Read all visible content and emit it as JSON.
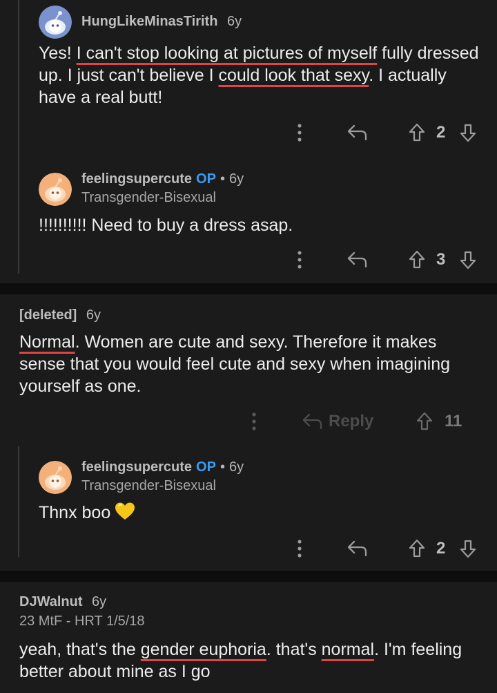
{
  "thread1": {
    "comment1": {
      "username": "HungLikeMinasTirith",
      "age": "6y",
      "body_parts": [
        "Yes! ",
        "I can't stop looking at pictures of myself",
        " fully dressed up. I just can't believe I ",
        "could look that sexy",
        ". I actually have a real butt!"
      ],
      "votes": "2"
    },
    "reply1": {
      "username": "feelingsupercute",
      "op_label": "OP",
      "age": "6y",
      "flair": "Transgender-Bisexual",
      "body": "!!!!!!!!!! Need to buy a dress asap.",
      "votes": "3"
    }
  },
  "thread2": {
    "comment1": {
      "username": "[deleted]",
      "age": "6y",
      "body_parts": [
        "Normal",
        ". Women are cute and sexy. Therefore it makes sense that you would feel cute and sexy when imagining yourself as one."
      ],
      "reply_label": "Reply",
      "votes": "11"
    },
    "reply1": {
      "username": "feelingsupercute",
      "op_label": "OP",
      "age": "6y",
      "flair": "Transgender-Bisexual",
      "body": "Thnx boo",
      "votes": "2"
    }
  },
  "thread3": {
    "comment1": {
      "username": "DJWalnut",
      "age": "6y",
      "flair": "23 MtF - HRT 1/5/18",
      "body_parts": [
        "yeah, that's the ",
        "gender euphoria",
        ". that's ",
        "normal",
        ". I'm feeling better about mine as I go"
      ]
    }
  },
  "icons": {
    "more": "more-vertical-icon",
    "reply": "reply-arrow-icon",
    "upvote": "upvote-arrow-icon",
    "downvote": "downvote-arrow-icon",
    "heart": "yellow-heart-emoji"
  },
  "colors": {
    "op": "#3a9bf0",
    "spellcheck": "#e04545",
    "heart": "#f5c518"
  }
}
